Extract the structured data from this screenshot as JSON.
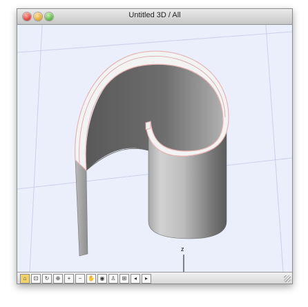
{
  "window": {
    "title": "Untitled 3D / All"
  },
  "axes": {
    "z_label": "z"
  },
  "toolbar": {
    "tools": [
      {
        "name": "select-tool",
        "glyph": "⌂"
      },
      {
        "name": "zoom-window-tool",
        "glyph": "⊡"
      },
      {
        "name": "rotate-view-tool",
        "glyph": "↻"
      },
      {
        "name": "zoom-in-out-tool",
        "glyph": "⊕"
      },
      {
        "name": "zoom-in-tool",
        "glyph": "+"
      },
      {
        "name": "zoom-out-tool",
        "glyph": "−"
      },
      {
        "name": "pan-tool",
        "glyph": "✋"
      },
      {
        "name": "view-options-tool",
        "glyph": "◉"
      },
      {
        "name": "walk-tool",
        "glyph": "♙"
      },
      {
        "name": "zoom-extents-tool",
        "glyph": "⊞"
      },
      {
        "name": "previous-view-tool",
        "glyph": "◂"
      },
      {
        "name": "next-view-tool",
        "glyph": "▸"
      }
    ]
  },
  "colors": {
    "viewport_bg": "#ebeefb",
    "surface_light": "#d3d3d3",
    "surface_dark": "#5f5f5f",
    "edge_highlight": "#e7b3b3"
  }
}
